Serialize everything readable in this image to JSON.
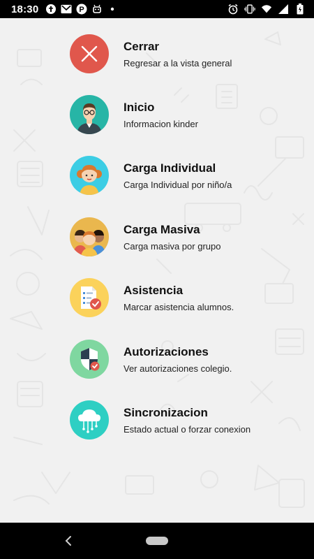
{
  "status_bar": {
    "time": "18:30",
    "left_icons": [
      "ticket-icon",
      "mail-icon",
      "parking-app-icon",
      "android-icon",
      "dot-icon"
    ],
    "right_icons": [
      "alarm-icon",
      "vibrate-icon",
      "wifi-icon",
      "signal-icon",
      "battery-icon"
    ]
  },
  "menu": {
    "items": [
      {
        "title": "Cerrar",
        "subtitle": "Regresar a la vista general",
        "icon": "close-icon",
        "icon_bg": "#e0574c"
      },
      {
        "title": "Inicio",
        "subtitle": "Informacion kinder",
        "icon": "teacher-avatar-icon",
        "icon_bg": "#27b5a6"
      },
      {
        "title": "Carga Individual",
        "subtitle": "Carga Individual por niño/a",
        "icon": "child-avatar-icon",
        "icon_bg": "#3ccde4"
      },
      {
        "title": "Carga Masiva",
        "subtitle": "Carga masiva por grupo",
        "icon": "children-group-icon",
        "icon_bg": "#eab74e"
      },
      {
        "title": "Asistencia",
        "subtitle": "Marcar asistencia alumnos.",
        "icon": "attendance-checklist-icon",
        "icon_bg": "#fbd25b"
      },
      {
        "title": "Autorizaciones",
        "subtitle": "Ver autorizaciones colegio.",
        "icon": "shield-check-icon",
        "icon_bg": "#7fd7a0"
      },
      {
        "title": "Sincronizacion",
        "subtitle": "Estado actual o forzar conexion",
        "icon": "cloud-sync-icon",
        "icon_bg": "#2ecfc3"
      }
    ]
  },
  "nav_bar": {
    "back_icon": "back-icon",
    "home_icon": "home-pill-icon"
  }
}
